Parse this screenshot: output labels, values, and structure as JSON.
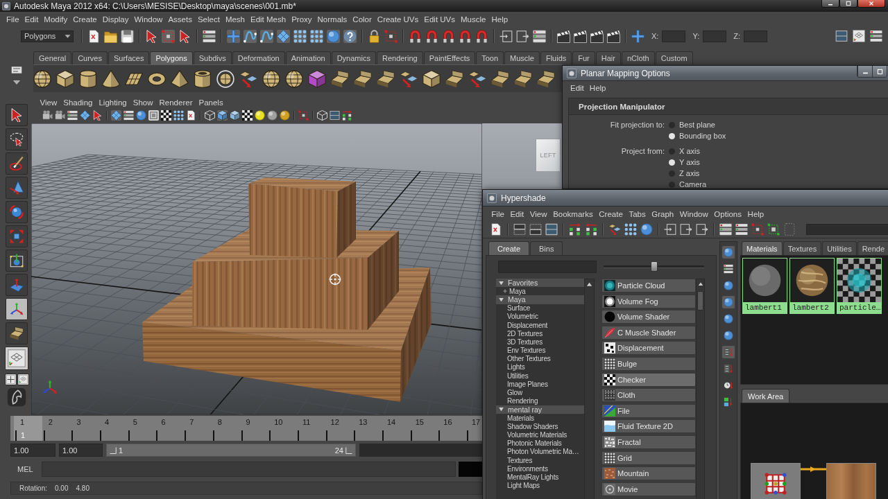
{
  "window": {
    "title": "Autodesk Maya 2012 x64: C:\\Users\\MESISE\\Desktop\\maya\\scenes\\001.mb*"
  },
  "main_menu": [
    "File",
    "Edit",
    "Modify",
    "Create",
    "Display",
    "Window",
    "Assets",
    "Select",
    "Mesh",
    "Edit Mesh",
    "Proxy",
    "Normals",
    "Color",
    "Create UVs",
    "Edit UVs",
    "Muscle",
    "Help"
  ],
  "status_line": {
    "menu_set": "Polygons",
    "coordinate_fields": [
      {
        "label": "X:"
      },
      {
        "label": "Y:"
      },
      {
        "label": "Z:"
      }
    ]
  },
  "shelf": {
    "tabs": [
      {
        "label": "General",
        "selected": false
      },
      {
        "label": "Curves",
        "selected": false
      },
      {
        "label": "Surfaces",
        "selected": false
      },
      {
        "label": "Polygons",
        "selected": true
      },
      {
        "label": "Subdivs",
        "selected": false
      },
      {
        "label": "Deformation",
        "selected": false
      },
      {
        "label": "Animation",
        "selected": false
      },
      {
        "label": "Dynamics",
        "selected": false
      },
      {
        "label": "Rendering",
        "selected": false
      },
      {
        "label": "PaintEffects",
        "selected": false
      },
      {
        "label": "Toon",
        "selected": false
      },
      {
        "label": "Muscle",
        "selected": false
      },
      {
        "label": "Fluids",
        "selected": false
      },
      {
        "label": "Fur",
        "selected": false
      },
      {
        "label": "Hair",
        "selected": false
      },
      {
        "label": "nCloth",
        "selected": false
      },
      {
        "label": "Custom",
        "selected": false
      }
    ]
  },
  "viewport": {
    "menu": [
      "View",
      "Shading",
      "Lighting",
      "Show",
      "Renderer",
      "Panels"
    ],
    "view_cube_label": "LEFT"
  },
  "time_slider": {
    "ticks": [
      {
        "label": "1",
        "selected": true
      },
      {
        "label": "2",
        "selected": false
      },
      {
        "label": "3",
        "selected": false
      },
      {
        "label": "4",
        "selected": false
      },
      {
        "label": "5",
        "selected": false
      },
      {
        "label": "6",
        "selected": false
      },
      {
        "label": "7",
        "selected": false
      },
      {
        "label": "8",
        "selected": false
      },
      {
        "label": "9",
        "selected": false
      },
      {
        "label": "10",
        "selected": false
      },
      {
        "label": "11",
        "selected": false
      },
      {
        "label": "12",
        "selected": false
      },
      {
        "label": "13",
        "selected": false
      },
      {
        "label": "14",
        "selected": false
      },
      {
        "label": "15",
        "selected": false
      },
      {
        "label": "16",
        "selected": false
      },
      {
        "label": "17",
        "selected": false
      }
    ],
    "current_frame": "1"
  },
  "range_slider": {
    "start_time": "1.00",
    "playback_start": "1.00",
    "range_start": "1",
    "range_end": "24"
  },
  "command_line": {
    "label": "MEL"
  },
  "help_line": {
    "label": "Rotation:",
    "values": [
      "0.00",
      "4.80"
    ]
  },
  "planar_mapping_options": {
    "title": "Planar Mapping Options",
    "menu": [
      "Edit",
      "Help"
    ],
    "section": "Projection Manipulator",
    "groups": [
      {
        "label": "Fit projection to:",
        "options": [
          {
            "label": "Best plane",
            "selected": false
          },
          {
            "label": "Bounding box",
            "selected": true
          }
        ]
      },
      {
        "label": "Project from:",
        "options": [
          {
            "label": "X axis",
            "selected": false
          },
          {
            "label": "Y axis",
            "selected": true
          },
          {
            "label": "Z axis",
            "selected": false
          },
          {
            "label": "Camera",
            "selected": false
          }
        ]
      }
    ]
  },
  "hypershade": {
    "title": "Hypershade",
    "menu": [
      "File",
      "Edit",
      "View",
      "Bookmarks",
      "Create",
      "Tabs",
      "Graph",
      "Window",
      "Options",
      "Help"
    ],
    "create_tabs": [
      {
        "label": "Create",
        "selected": true
      },
      {
        "label": "Bins",
        "selected": false
      }
    ],
    "icon_size_slider": {
      "level": 0.5
    },
    "tree": [
      {
        "label": "Favorites",
        "expanded": true,
        "children": [
          {
            "label": "Maya",
            "kind": "favorite"
          }
        ]
      },
      {
        "label": "Maya",
        "expanded": true,
        "children": [
          {
            "label": "Surface",
            "kind": "category"
          },
          {
            "label": "Volumetric",
            "kind": "category"
          },
          {
            "label": "Displacement",
            "kind": "category"
          },
          {
            "label": "2D Textures",
            "kind": "category"
          },
          {
            "label": "3D Textures",
            "kind": "category"
          },
          {
            "label": "Env Textures",
            "kind": "category"
          },
          {
            "label": "Other Textures",
            "kind": "category"
          },
          {
            "label": "Lights",
            "kind": "category"
          },
          {
            "label": "Utilities",
            "kind": "category"
          },
          {
            "label": "Image Planes",
            "kind": "category"
          },
          {
            "label": "Glow",
            "kind": "category"
          },
          {
            "label": "Rendering",
            "kind": "category"
          }
        ]
      },
      {
        "label": "mental ray",
        "expanded": true,
        "children": [
          {
            "label": "Materials",
            "kind": "category"
          },
          {
            "label": "Shadow Shaders",
            "kind": "category"
          },
          {
            "label": "Volumetric Materials",
            "kind": "category"
          },
          {
            "label": "Photonic Materials",
            "kind": "category"
          },
          {
            "label": "Photon Volumetric Ma…",
            "kind": "category"
          },
          {
            "label": "Textures",
            "kind": "category"
          },
          {
            "label": "Environments",
            "kind": "category"
          },
          {
            "label": "MentalRay Lights",
            "kind": "category"
          },
          {
            "label": "Light Maps",
            "kind": "category"
          }
        ]
      }
    ],
    "nodes": [
      {
        "label": "Particle Cloud",
        "selected": false
      },
      {
        "label": "Volume Fog",
        "selected": false
      },
      {
        "label": "Volume Shader",
        "selected": false
      },
      {
        "label": "C Muscle Shader",
        "selected": false
      },
      {
        "label": "Displacement",
        "selected": false
      },
      {
        "label": "Bulge",
        "selected": false
      },
      {
        "label": "Checker",
        "selected": true
      },
      {
        "label": "Cloth",
        "selected": false
      },
      {
        "label": "File",
        "selected": false
      },
      {
        "label": "Fluid Texture 2D",
        "selected": false
      },
      {
        "label": "Fractal",
        "selected": false
      },
      {
        "label": "Grid",
        "selected": false
      },
      {
        "label": "Mountain",
        "selected": false
      },
      {
        "label": "Movie",
        "selected": false
      }
    ],
    "bin_tabs": [
      {
        "label": "Materials",
        "selected": true
      },
      {
        "label": "Textures",
        "selected": false
      },
      {
        "label": "Utilities",
        "selected": false
      },
      {
        "label": "Rende",
        "selected": false
      }
    ],
    "swatches": [
      {
        "label": "lambert1"
      },
      {
        "label": "lambert2"
      },
      {
        "label": "particle…"
      }
    ],
    "work_area_tab": "Work Area"
  }
}
